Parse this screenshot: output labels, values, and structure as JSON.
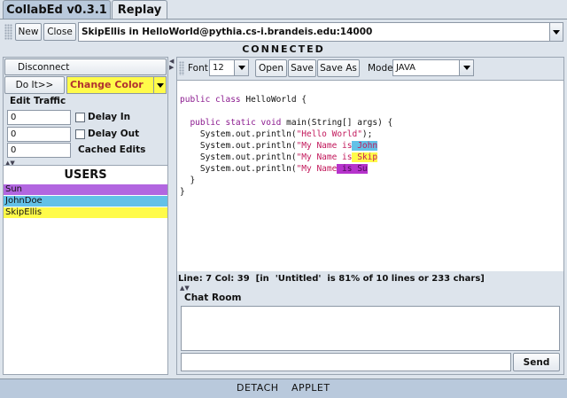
{
  "tabs": [
    {
      "label": "CollabEd v0.3.1",
      "active": true
    },
    {
      "label": "Replay",
      "active": false
    }
  ],
  "toolbar": {
    "new_label": "New",
    "close_label": "Close",
    "session": "SkipEllis in HelloWorld@pythia.cs-i.brandeis.edu:14000"
  },
  "status": "CONNECTED",
  "left": {
    "disconnect_label": "Disconnect",
    "doit_label": "Do It>>",
    "action_select": "Change Color",
    "edit_traffic_title": "Edit Traffic",
    "delay_in_value": "0",
    "delay_in_label": "Delay In",
    "delay_out_value": "0",
    "delay_out_label": "Delay Out",
    "cached_value": "0",
    "cached_label": "Cached Edits",
    "users_title": "USERS",
    "users": [
      {
        "name": "Sun",
        "color": "#b266e0"
      },
      {
        "name": "JohnDoe",
        "color": "#63c1e7"
      },
      {
        "name": "SkipEllis",
        "color": "#fffb4a"
      }
    ]
  },
  "editor_toolbar": {
    "font_label": "Font",
    "font_size": "12",
    "open_label": "Open",
    "save_label": "Save",
    "saveas_label": "Save As",
    "mode_label": "Mode",
    "mode_value": "JAVA"
  },
  "code": {
    "l1_kw": "public class",
    "l1_rest": " HelloWorld {",
    "l3_kw": "public static void",
    "l3_rest": " main(String[] args) {",
    "l4_a": "System.out.println(",
    "l4_s": "\"Hello World\"",
    "l4_b": ");",
    "l5_a": "System.out.println(",
    "l5_s": "\"My Name is",
    "l5_h": " John",
    "l6_a": "System.out.println(",
    "l6_s": "\"My Name is",
    "l6_h": " Skip",
    "l7_a": "System.out.println(",
    "l7_s": "\"My Name",
    "l7_h": " is Su",
    "l8": "}",
    "l9": "}"
  },
  "highlight_colors": {
    "john": "#63c1e7",
    "skip": "#fffb4a",
    "sun": "#b633cc"
  },
  "editor_status": "Line: 7 Col: 39  [in  'Untitled'  is 81% of 10 lines or 233 chars]",
  "chat": {
    "title": "Chat Room",
    "input_value": "",
    "send_label": "Send"
  },
  "footer": {
    "detach_label": "DETACH",
    "applet_label": "APPLET"
  }
}
